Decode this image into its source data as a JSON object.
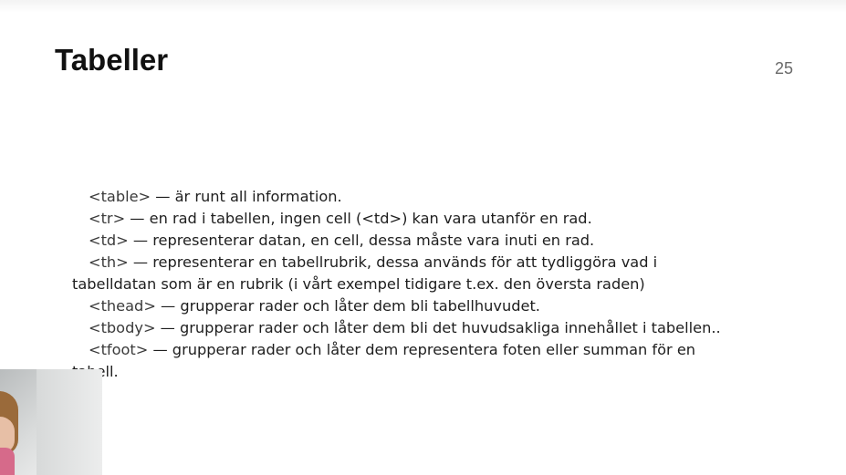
{
  "slide": {
    "title": "Tabeller",
    "page_number": "25"
  },
  "content": {
    "items": [
      {
        "tag": "<table>",
        "text": " — är runt all information."
      },
      {
        "tag": "<tr>",
        "text": " — en rad i tabellen, ingen cell (<td>) kan vara utanför en rad."
      },
      {
        "tag": "<td>",
        "text": " — representerar datan, en cell, dessa måste vara inuti en rad."
      },
      {
        "tag": "<th>",
        "text": " — representerar en tabellrubrik, dessa används för att tydliggöra vad i",
        "continuation": "tabelldatan som är en rubrik (i vårt exempel tidigare t.ex. den översta raden)"
      },
      {
        "tag": "<thead>",
        "text": " — grupperar rader och låter dem bli tabellhuvudet."
      },
      {
        "tag": "<tbody>",
        "text": " — grupperar rader och låter dem bli det huvudsakliga innehållet i tabellen.."
      },
      {
        "tag": "<tfoot>",
        "text": " — grupperar rader och låter dem representera foten eller summan för en",
        "continuation": "tabell."
      }
    ]
  },
  "webcam": {
    "icon": "webcam-person-overlay"
  }
}
